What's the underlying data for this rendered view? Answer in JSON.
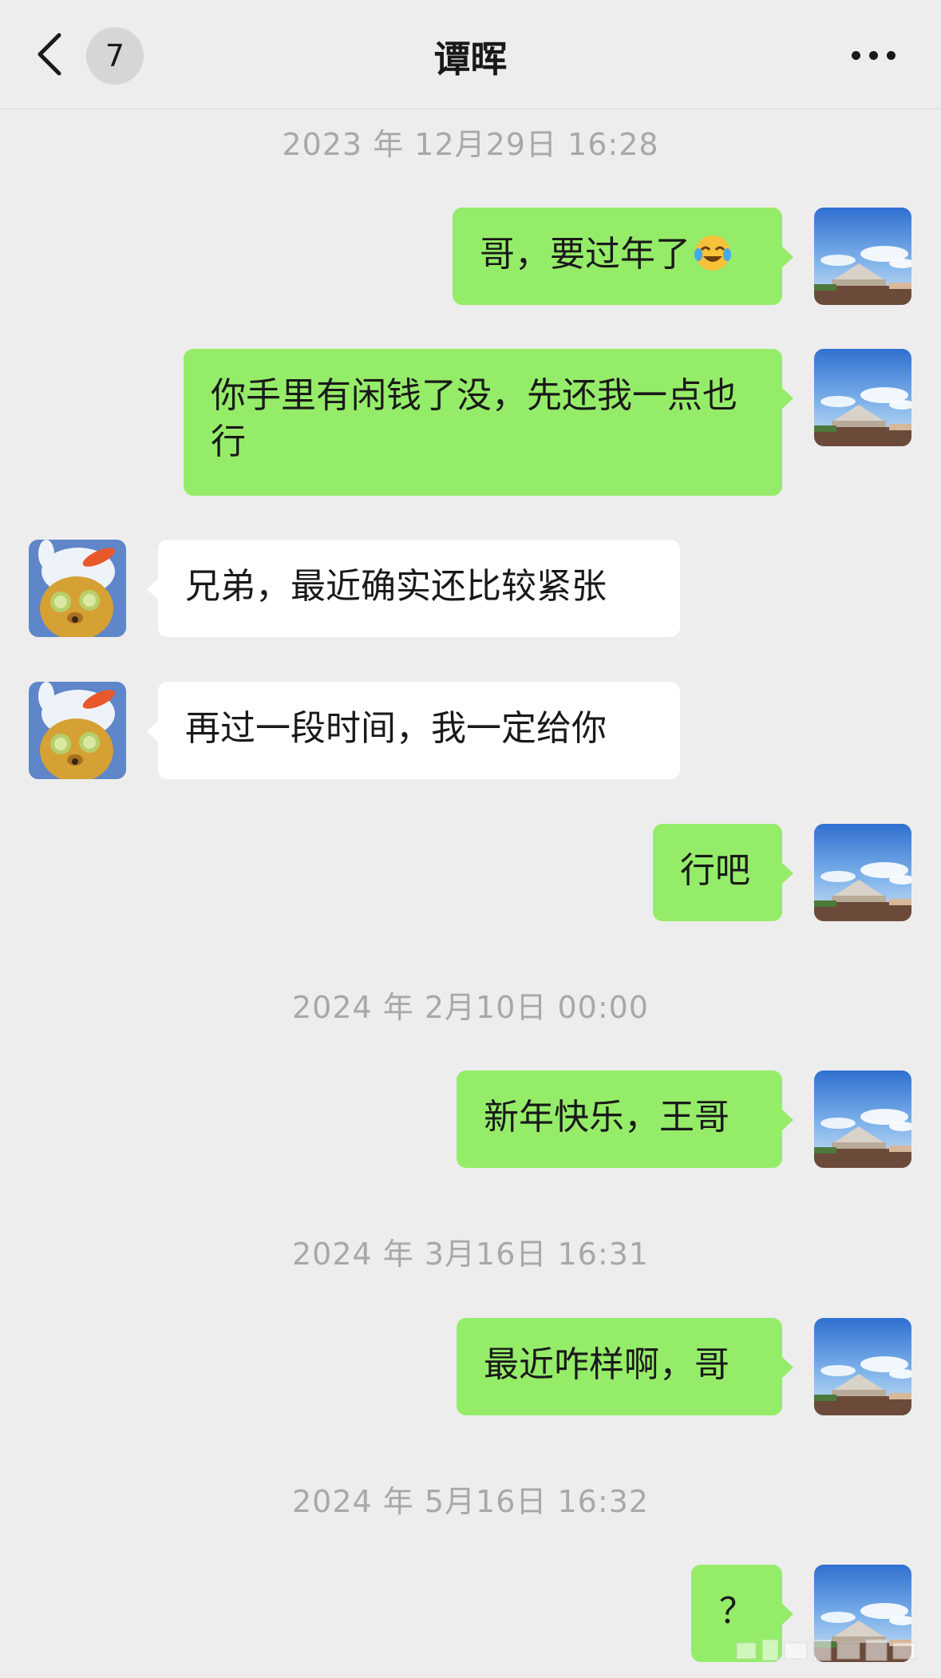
{
  "header": {
    "back_icon": "chevron-left-icon",
    "unread_count": "7",
    "title": "谭晖",
    "more_icon": "more-horizontal-icon"
  },
  "messages": [
    {
      "type": "timestamp",
      "text": "2023 年 12月29日 16:28"
    },
    {
      "type": "message",
      "direction": "out",
      "text": "哥，要过年了",
      "emoji": "laughing-crying-emoji-icon"
    },
    {
      "type": "message",
      "direction": "out",
      "text": "你手里有闲钱了没，先还我一点也行"
    },
    {
      "type": "message",
      "direction": "in",
      "text": "兄弟，最近确实还比较紧张"
    },
    {
      "type": "message",
      "direction": "in",
      "text": "再过一段时间，我一定给你"
    },
    {
      "type": "message",
      "direction": "out",
      "text": "行吧"
    },
    {
      "type": "timestamp",
      "text": "2024 年 2月10日 00:00"
    },
    {
      "type": "message",
      "direction": "out",
      "text": "新年快乐，王哥"
    },
    {
      "type": "timestamp",
      "text": "2024 年 3月16日 16:31"
    },
    {
      "type": "message",
      "direction": "out",
      "text": "最近咋样啊，哥"
    },
    {
      "type": "timestamp",
      "text": "2024 年 5月16日 16:32"
    },
    {
      "type": "message",
      "direction": "out",
      "text": "？"
    }
  ],
  "colors": {
    "background": "#ededed",
    "outgoing_bubble": "#95ec69",
    "incoming_bubble": "#ffffff",
    "timestamp_text": "#a8a8a8"
  },
  "avatars": {
    "me": "landscape-avatar-icon",
    "other": "teddy-bear-avatar-icon"
  }
}
